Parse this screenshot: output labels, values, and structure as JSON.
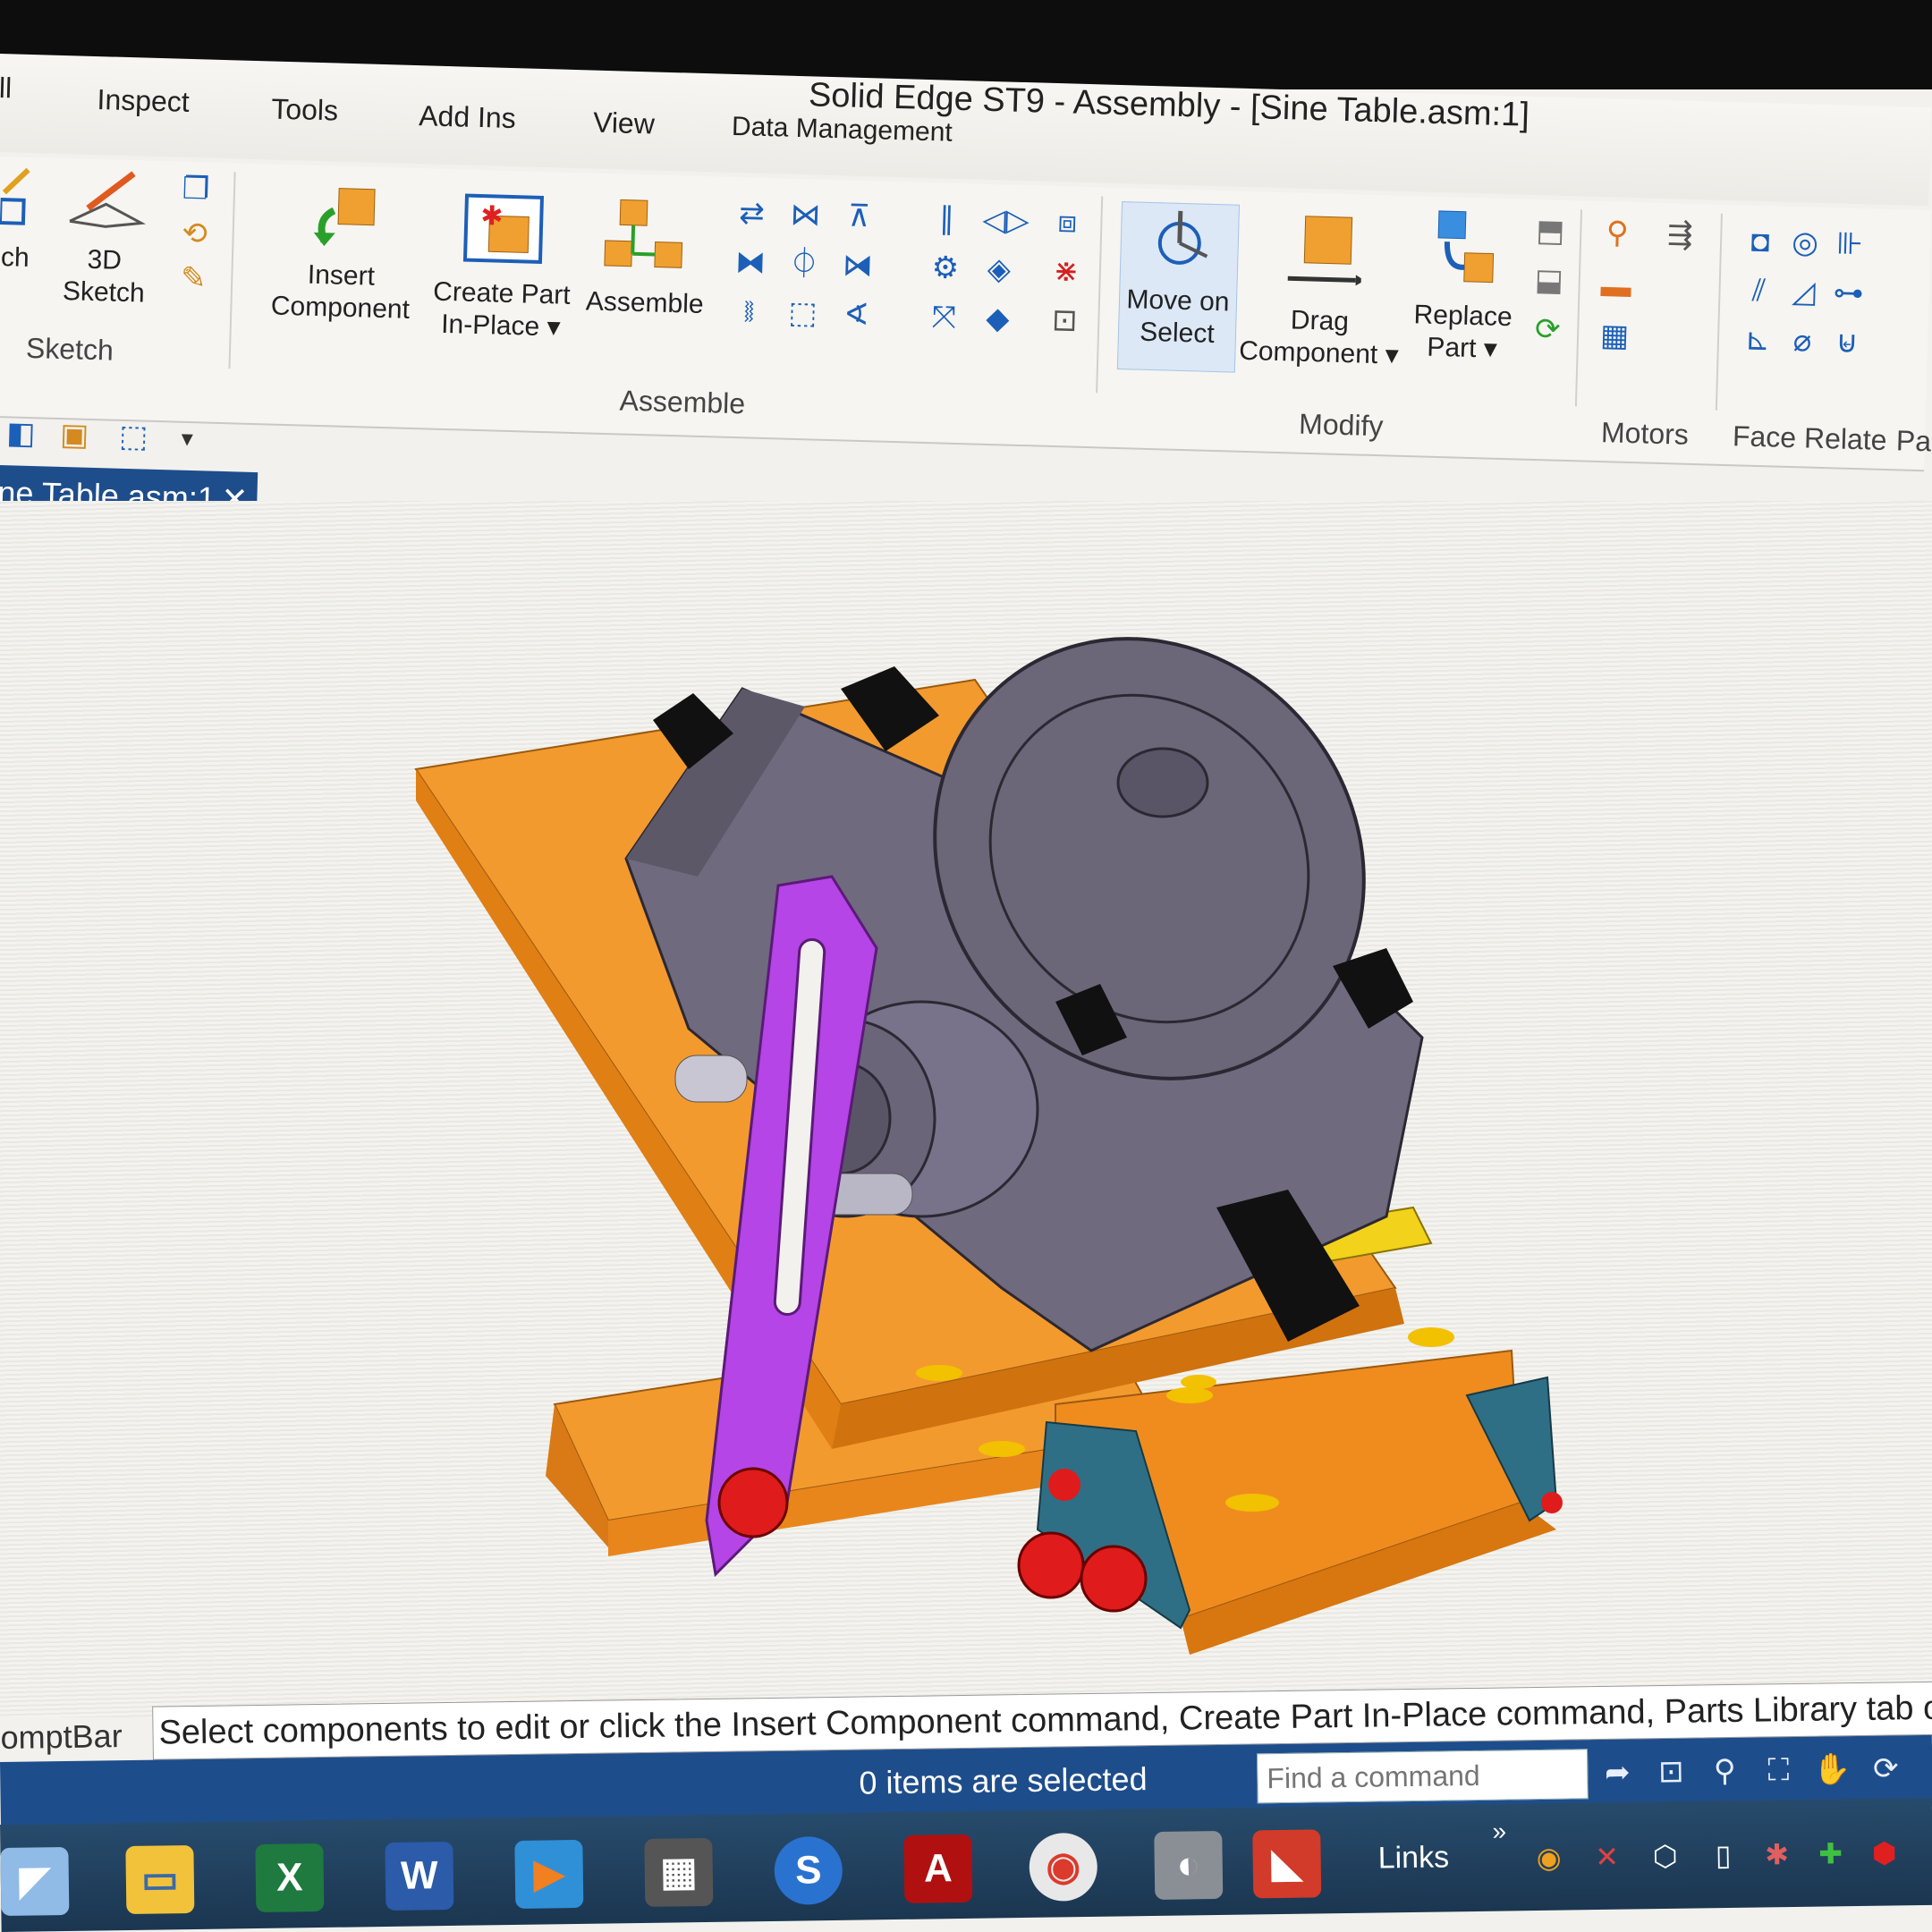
{
  "window": {
    "title": "Solid Edge ST9 - Assembly - [Sine Table.asm:1]"
  },
  "menu_tabs": [
    "Inspect",
    "Tools",
    "Add Ins",
    "View",
    "Data Management"
  ],
  "menu_partial_left": "ll",
  "ribbon": {
    "sketch_group": {
      "partial_label": "ch",
      "sketch3d_line1": "3D",
      "sketch3d_line2": "Sketch",
      "group_label": "Sketch"
    },
    "assemble_group": {
      "insert_line1": "Insert",
      "insert_line2": "Component",
      "create_line1": "Create Part",
      "create_line2": "In-Place ▾",
      "assemble_label": "Assemble",
      "group_label": "Assemble"
    },
    "modify_group": {
      "move_line1": "Move on",
      "move_line2": "Select",
      "drag_line1": "Drag",
      "drag_line2": "Component ▾",
      "replace_line1": "Replace",
      "replace_line2": "Part ▾",
      "group_label": "Modify"
    },
    "motors_group": {
      "group_label": "Motors"
    },
    "face_relate_group": {
      "group_label": "Face Relate"
    },
    "partial_right_label": "Pa"
  },
  "document_tab": {
    "label": "ne Table.asm:1",
    "close_glyph": "✕"
  },
  "prompt_bar": {
    "label": "omptBar",
    "text": "Select components to edit or click the Insert Component command, Create Part In-Place command, Parts Library tab or dra"
  },
  "status_bar": {
    "selection_text": "0 items are selected",
    "find_placeholder": "Find a command"
  },
  "taskbar": {
    "links_label": "Links",
    "links_chevron": "»",
    "apps": [
      "start",
      "file-explorer",
      "excel",
      "word",
      "media-player",
      "calculator",
      "sync",
      "acrobat",
      "chrome",
      "mouse-utility",
      "solid-edge"
    ]
  },
  "colors": {
    "accent_blue": "#1e4d8c",
    "base_orange": "#f08c1e",
    "body_gray": "#6f6a7d",
    "link_purple": "#b545e6",
    "block_yellow": "#f2d21a",
    "bolt_red": "#e01b1b",
    "bracket_teal": "#2f6f86"
  }
}
